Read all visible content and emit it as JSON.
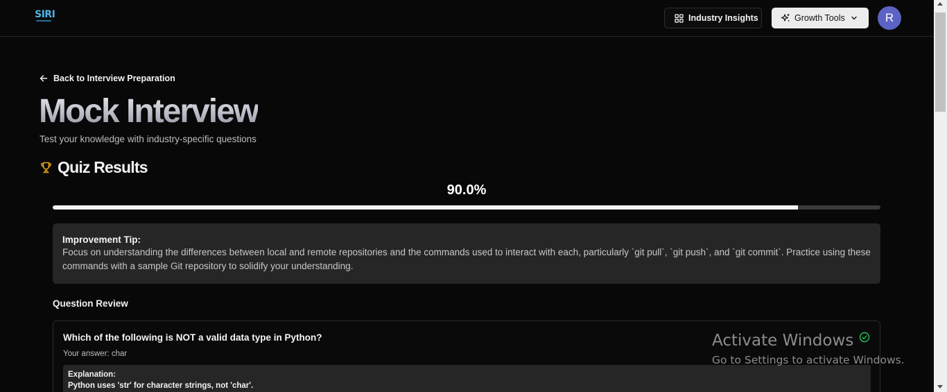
{
  "header": {
    "logo_text": "SIRI",
    "insights_label": "Industry Insights",
    "growth_label": "Growth Tools",
    "avatar_initial": "R"
  },
  "main": {
    "back_label": "Back to Interview Preparation",
    "title": "Mock Interview",
    "subtitle": "Test your knowledge with industry-specific questions",
    "results_heading": "Quiz Results",
    "score_text": "90.0%",
    "score_fraction": 0.9,
    "tip": {
      "title": "Improvement Tip:",
      "body": "Focus on understanding the differences between local and remote repositories and the commands used to interact with each, particularly `git pull`, `git push`, and `git commit`. Practice using these commands with a sample Git repository to solidify your understanding."
    },
    "review_heading": "Question Review",
    "questions": [
      {
        "question": "Which of the following is NOT a valid data type in Python?",
        "answer": "Your answer: char",
        "explanation_title": "Explanation:",
        "explanation": "Python uses 'str' for character strings, not 'char'.",
        "correct": true
      }
    ]
  },
  "watermark": {
    "title": "Activate Windows",
    "subtitle": "Go to Settings to activate Windows."
  },
  "colors": {
    "background": "#080808",
    "card": "#262626",
    "avatar": "#5c63c4",
    "trophy": "#e8a317",
    "check": "#22c55e"
  },
  "icons": {
    "insights": "layout-grid-icon",
    "growth": "sparkles-icon",
    "growth_dropdown": "chevron-down-icon",
    "back": "arrow-left-icon",
    "results": "trophy-icon",
    "question_status": "check-circle-icon"
  }
}
